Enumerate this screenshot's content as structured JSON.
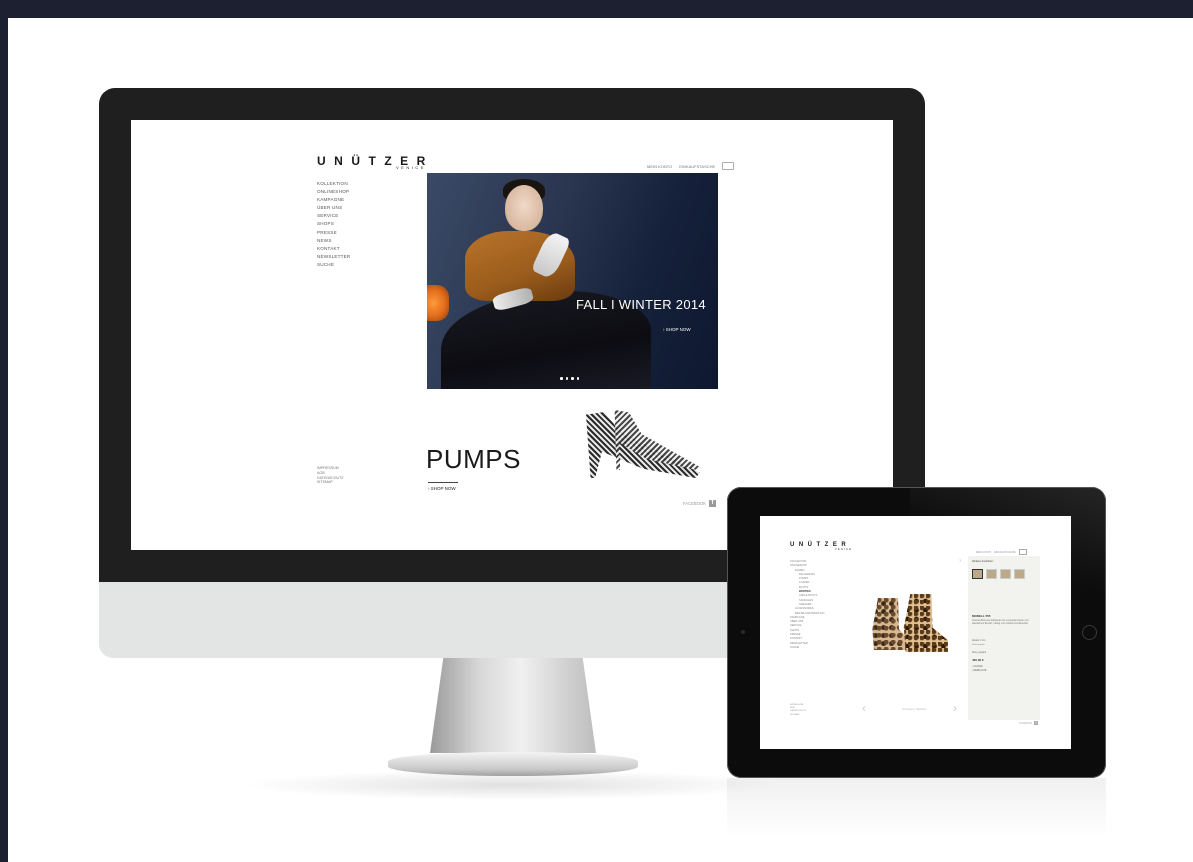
{
  "imac": {
    "logo_main": "UNÜTZER",
    "logo_sub": "VENICE",
    "topnav": {
      "account": "MEIN KONTO",
      "cart": "EINKAUFSTASCHE"
    },
    "nav": [
      "KOLLEKTION",
      "ONLINESHOP",
      "KAMPAGNE",
      "ÜBER UNS",
      "SERVICE",
      "SHOPS",
      "PRESSE",
      "NEWS",
      "KONTAKT",
      "NEWSLETTER",
      "SUCHE"
    ],
    "footer": [
      "IMPRESSUM",
      "AGB",
      "DATENSCHUTZ",
      "SITEMAP"
    ],
    "hero": {
      "title": "FALL I WINTER 2014",
      "cta": "› SHOP NOW",
      "slide_count": 4
    },
    "promo": {
      "title": "PUMPS",
      "cta": "› SHOP NOW"
    },
    "social": {
      "label": "FACEBOOK",
      "icon": "facebook-icon"
    }
  },
  "ipad": {
    "logo_main": "UNÜTZER",
    "logo_sub": "VENICE",
    "topnav": {
      "account": "MEIN KONTO",
      "cart": "EINKAUFSTASCHE"
    },
    "nav": [
      {
        "label": "KOLLEKTION",
        "level": 0
      },
      {
        "label": "ONLINESHOP",
        "level": 0
      },
      {
        "label": "DAMEN",
        "level": 1
      },
      {
        "label": "BALLERINAS",
        "level": 2
      },
      {
        "label": "PUMPS",
        "level": 2
      },
      {
        "label": "LOAFER",
        "level": 2
      },
      {
        "label": "BOOTS",
        "level": 2
      },
      {
        "label": "BOOTIES",
        "level": 2,
        "active": true
      },
      {
        "label": "ANKLE BOOTS",
        "level": 2
      },
      {
        "label": "SANDALEN",
        "level": 2
      },
      {
        "label": "SNEAKER",
        "level": 2
      },
      {
        "label": "ACCESSOIRES",
        "level": 1
      },
      {
        "label": "BESTELLINFORMATION",
        "level": 1
      },
      {
        "label": "KAMPAGNE",
        "level": 0
      },
      {
        "label": "ÜBER UNS",
        "level": 0
      },
      {
        "label": "SERVICE",
        "level": 0
      },
      {
        "label": "SHOPS",
        "level": 0
      },
      {
        "label": "PRESSE",
        "level": 0
      },
      {
        "label": "KONTAKT",
        "level": 0
      },
      {
        "label": "NEWSLETTER",
        "level": 0
      },
      {
        "label": "SUCHE",
        "level": 0
      }
    ],
    "footer": [
      "IMPRESSUM",
      "AGB",
      "DATENSCHUTZ",
      "SITEMAP"
    ],
    "product": {
      "panel_title": "Weitere Ansichten:",
      "model": "MODELL 555",
      "description": "Chelsea Boot aus Kalbsleder mit Leopardenmuster und elastischem Einsatz. Lässig und modisch kombinierbar.",
      "size_label": "Absatz: 2 cm",
      "size_value": "Einheitsgröße",
      "price_label": "Preis, gesamt",
      "price": "495,00 €",
      "cta_cart": "› KAUFEN",
      "cta_wishlist": "› MERKLISTE",
      "help": "?",
      "pager": "Vorheriges | Nächstes"
    },
    "social": {
      "label": "FACEBOOK",
      "icon": "facebook-icon"
    }
  }
}
